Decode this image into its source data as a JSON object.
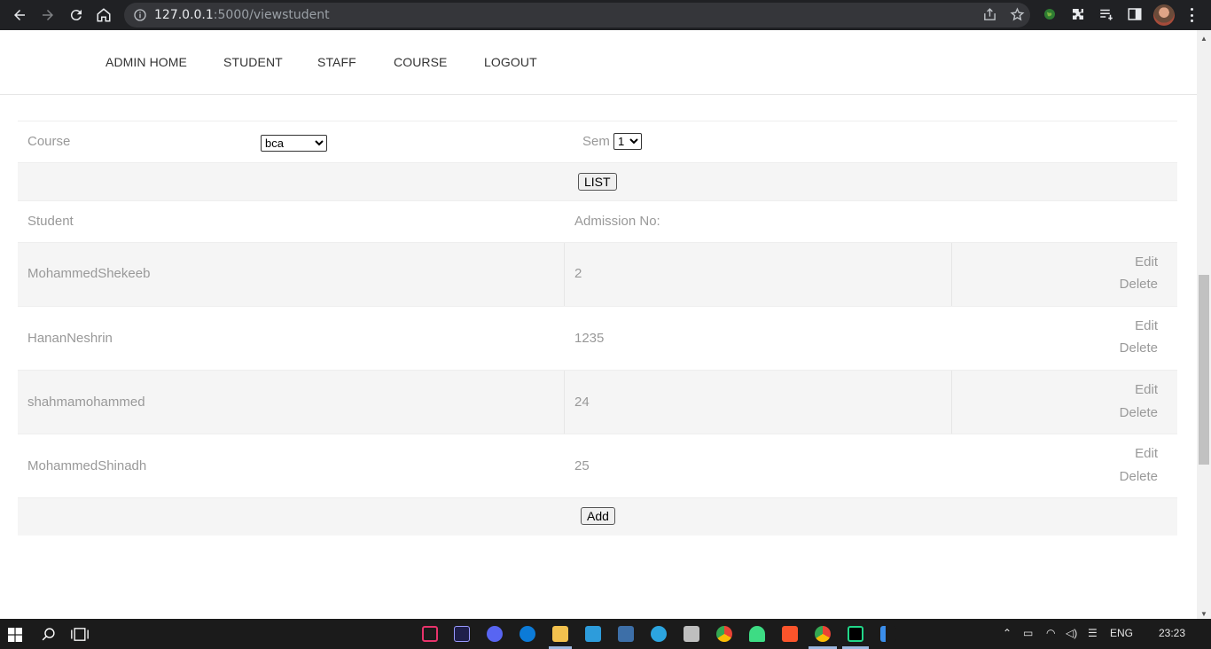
{
  "browser": {
    "url_host": "127.0.0.1",
    "url_rest": ":5000/viewstudent"
  },
  "nav": {
    "items": [
      "ADMIN HOME",
      "STUDENT",
      "STAFF",
      "COURSE",
      "LOGOUT"
    ]
  },
  "filter": {
    "course_label": "Course",
    "course_value": "bca",
    "sem_label": "Sem",
    "sem_value": "1",
    "list_button": "LIST"
  },
  "table": {
    "headers": [
      "Student",
      "Admission No:"
    ],
    "rows": [
      {
        "name": "MohammedShekeeb",
        "admission": "2"
      },
      {
        "name": "HananNeshrin",
        "admission": "1235"
      },
      {
        "name": "shahmamohammed",
        "admission": "24"
      },
      {
        "name": "MohammedShinadh",
        "admission": "25"
      }
    ],
    "edit_label": "Edit",
    "delete_label": "Delete",
    "add_button": "Add"
  },
  "taskbar": {
    "language": "ENG",
    "time": "23:23"
  },
  "icons": [
    "back-icon",
    "forward-icon",
    "reload-icon",
    "home-icon",
    "info-icon",
    "share-icon",
    "star-icon",
    "puzzle-icon",
    "reading-list-icon",
    "sidepanel-icon",
    "windows-start-icon",
    "search-icon",
    "task-view-icon"
  ]
}
